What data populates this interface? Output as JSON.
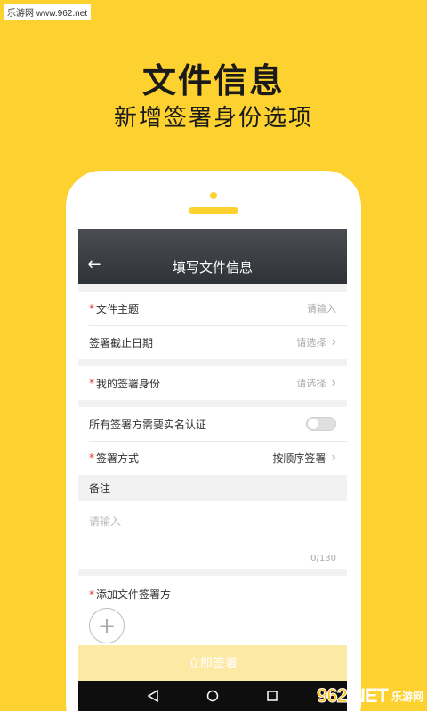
{
  "watermark": {
    "top_left": "乐游网 www.962.net",
    "bottom_right_logo_num": "962",
    "bottom_right_logo_txt": ".NET",
    "bottom_right_sub": "乐游网"
  },
  "promo": {
    "title": "文件信息",
    "subtitle": "新增签署身份选项"
  },
  "appbar": {
    "back_icon": "←",
    "title": "填写文件信息"
  },
  "form": {
    "doc_subject": {
      "required_mark": "*",
      "label": "文件主题",
      "placeholder": "请输入"
    },
    "deadline": {
      "label": "签署截止日期",
      "value": "请选择"
    },
    "my_identity": {
      "required_mark": "*",
      "label": "我的签署身份",
      "value": "请选择"
    },
    "realname": {
      "label": "所有签署方需要实名认证",
      "enabled": false
    },
    "sign_method": {
      "required_mark": "*",
      "label": "签署方式",
      "value": "按顺序签署"
    },
    "notes": {
      "header": "备注",
      "placeholder": "请输入",
      "counter": "0/130"
    },
    "signers": {
      "required_mark": "*",
      "label": "添加文件签署方",
      "add_icon": "+"
    }
  },
  "submit": {
    "label": "立即签署"
  },
  "colors": {
    "background": "#FDD12F",
    "accent": "#FDD12F",
    "required": "#E5322D",
    "submit_bg": "#FCE9A4",
    "appbar": "#3A3D41"
  }
}
